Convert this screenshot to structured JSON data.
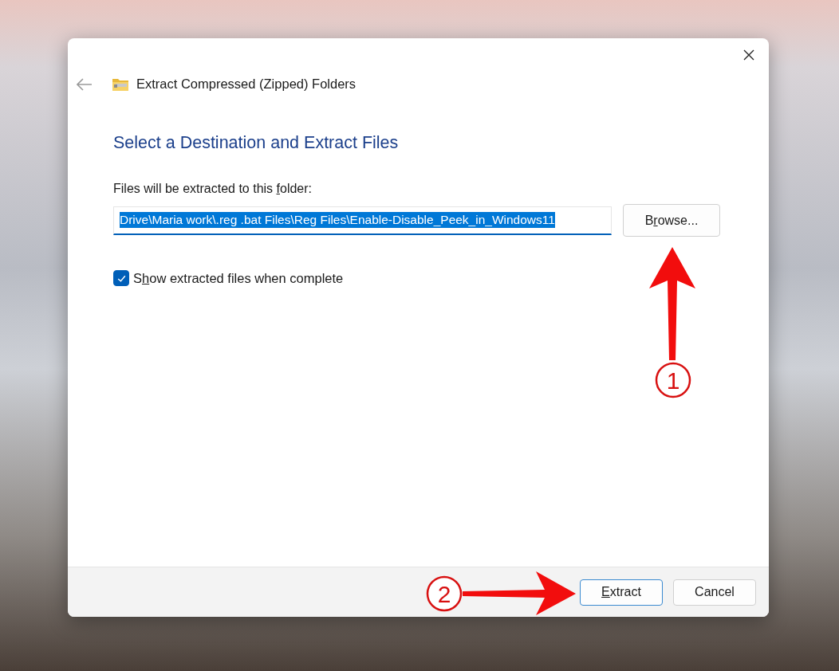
{
  "dialog": {
    "title": "Extract Compressed (Zipped) Folders",
    "heading": "Select a Destination and Extract Files",
    "destination_label": [
      {
        "text": "Files will be extracted to this ",
        "underlined": false
      },
      {
        "text": "f",
        "underlined": true
      },
      {
        "text": "older:",
        "underlined": false
      }
    ],
    "destination_value": "Drive\\Maria work\\.reg .bat Files\\Reg Files\\Enable-Disable_Peek_in_Windows11",
    "browse_button": [
      {
        "text": "B",
        "underlined": false
      },
      {
        "text": "r",
        "underlined": true
      },
      {
        "text": "owse...",
        "underlined": false
      }
    ],
    "show_files_checkbox": {
      "label": [
        {
          "text": "S",
          "underlined": false
        },
        {
          "text": "h",
          "underlined": true
        },
        {
          "text": "ow extracted files when complete",
          "underlined": false
        }
      ],
      "checked": true
    },
    "buttons": [
      {
        "label": [
          {
            "text": "E",
            "underlined": true
          },
          {
            "text": "xtract",
            "underlined": false
          }
        ],
        "default": true
      },
      {
        "label": [
          {
            "text": "Cancel",
            "underlined": false
          }
        ],
        "default": false
      }
    ]
  },
  "annotations": [
    {
      "number": "1",
      "kind": "up-arrow"
    },
    {
      "number": "2",
      "kind": "right-arrow"
    }
  ]
}
